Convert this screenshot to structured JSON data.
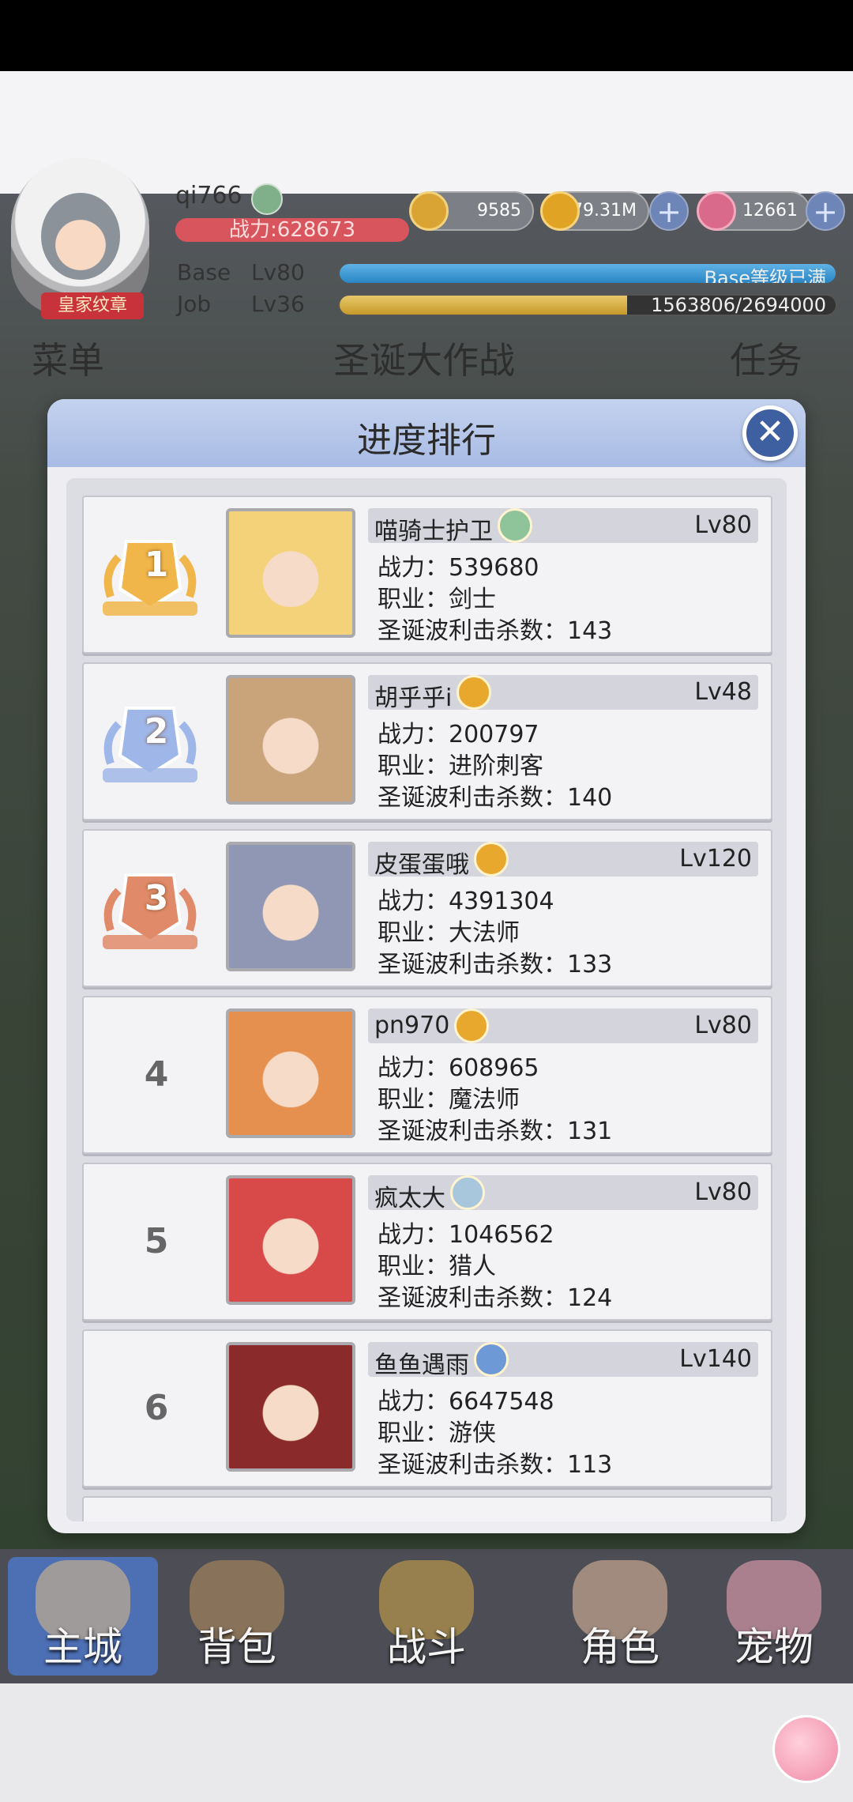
{
  "hud": {
    "player_name": "qi766",
    "power_label": "战力:628673",
    "royal_badge": "皇家纹章",
    "zeny": "9585",
    "gold": "79.31M",
    "gems": "12661",
    "base_label": "Base",
    "base_level": "Lv80",
    "base_status": "Base等级已满",
    "base_progress": 1.0,
    "job_label": "Job",
    "job_level": "Lv36",
    "job_exp": "1563806/2694000",
    "job_progress": 0.58,
    "plus": "+"
  },
  "subtabs": {
    "menu": "菜单",
    "event": "圣诞大作战",
    "quest": "任务"
  },
  "dialog": {
    "title": "进度排行",
    "close": "✕",
    "rows": [
      {
        "rank": "1",
        "name": "喵骑士护卫",
        "level": "Lv80",
        "power": "战力：539680",
        "job": "职业：剑士",
        "kills": "圣诞波利击杀数：143",
        "icon_color": "#8fc49a"
      },
      {
        "rank": "2",
        "name": "胡乎乎i",
        "level": "Lv48",
        "power": "战力：200797",
        "job": "职业：进阶刺客",
        "kills": "圣诞波利击杀数：140",
        "icon_color": "#e8a82e"
      },
      {
        "rank": "3",
        "name": "皮蛋蛋哦",
        "level": "Lv120",
        "power": "战力：4391304",
        "job": "职业：大法师",
        "kills": "圣诞波利击杀数：133",
        "icon_color": "#e8a82e"
      },
      {
        "rank": "4",
        "name": "pn970",
        "level": "Lv80",
        "power": "战力：608965",
        "job": "职业：魔法师",
        "kills": "圣诞波利击杀数：131",
        "icon_color": "#e8a82e"
      },
      {
        "rank": "5",
        "name": "疯太大",
        "level": "Lv80",
        "power": "战力：1046562",
        "job": "职业：猎人",
        "kills": "圣诞波利击杀数：124",
        "icon_color": "#a9c7dc"
      },
      {
        "rank": "6",
        "name": "鱼鱼遇雨",
        "level": "Lv140",
        "power": "战力：6647548",
        "job": "职业：游侠",
        "kills": "圣诞波利击杀数：113",
        "icon_color": "#6d9ad6"
      }
    ]
  },
  "nav": {
    "city": "主城",
    "bag": "背包",
    "battle": "战斗",
    "role": "角色",
    "pet": "宠物"
  }
}
